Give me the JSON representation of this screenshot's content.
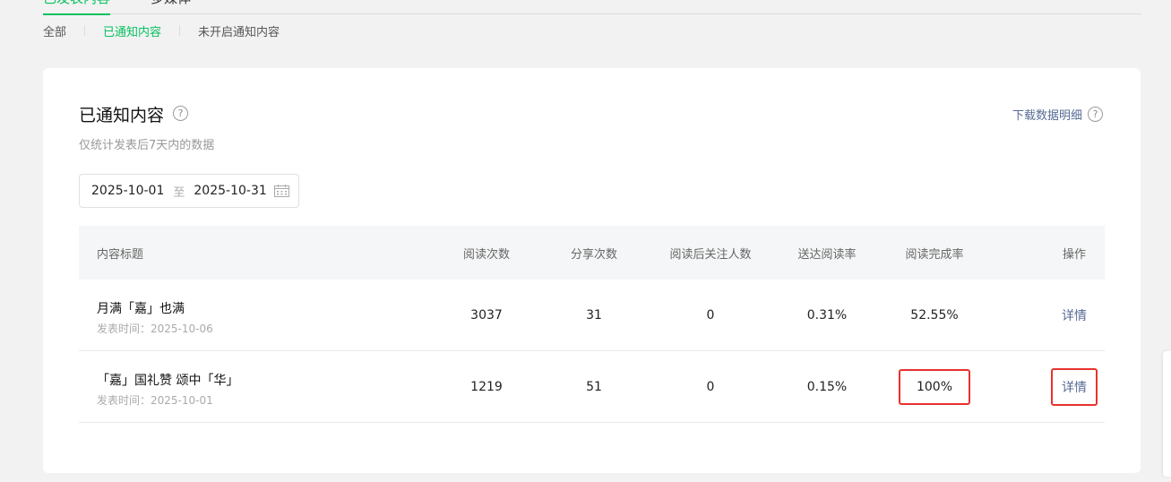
{
  "top_tabs": [
    {
      "label": "已发表内容",
      "active": true
    },
    {
      "label": "多媒体",
      "active": false
    }
  ],
  "sub_tabs": [
    {
      "label": "全部",
      "active": false
    },
    {
      "label": "已通知内容",
      "active": true
    },
    {
      "label": "未开启通知内容",
      "active": false
    }
  ],
  "card": {
    "title": "已通知内容",
    "subtitle": "仅统计发表后7天内的数据",
    "download_label": "下载数据明细",
    "help_icon": "?"
  },
  "date_range": {
    "start": "2025-10-01",
    "separator": "至",
    "end": "2025-10-31"
  },
  "table": {
    "headers": {
      "title": "内容标题",
      "read": "阅读次数",
      "share": "分享次数",
      "follow": "阅读后关注人数",
      "deliver": "送达阅读率",
      "complete": "阅读完成率",
      "op": "操作"
    },
    "rows": [
      {
        "title": "月满「嘉」也满",
        "date": "发表时间：2025-10-06",
        "read": "3037",
        "share": "31",
        "follow": "0",
        "deliver": "0.31%",
        "complete": "52.55%",
        "op": "详情"
      },
      {
        "title": "「嘉」国礼赞 颂中「华」",
        "date": "发表时间：2025-10-01",
        "read": "1219",
        "share": "51",
        "follow": "0",
        "deliver": "0.15%",
        "complete": "100%",
        "op": "详情"
      }
    ]
  },
  "colors": {
    "accent": "#07c160",
    "link": "#576b95",
    "highlight": "#e8322e"
  }
}
